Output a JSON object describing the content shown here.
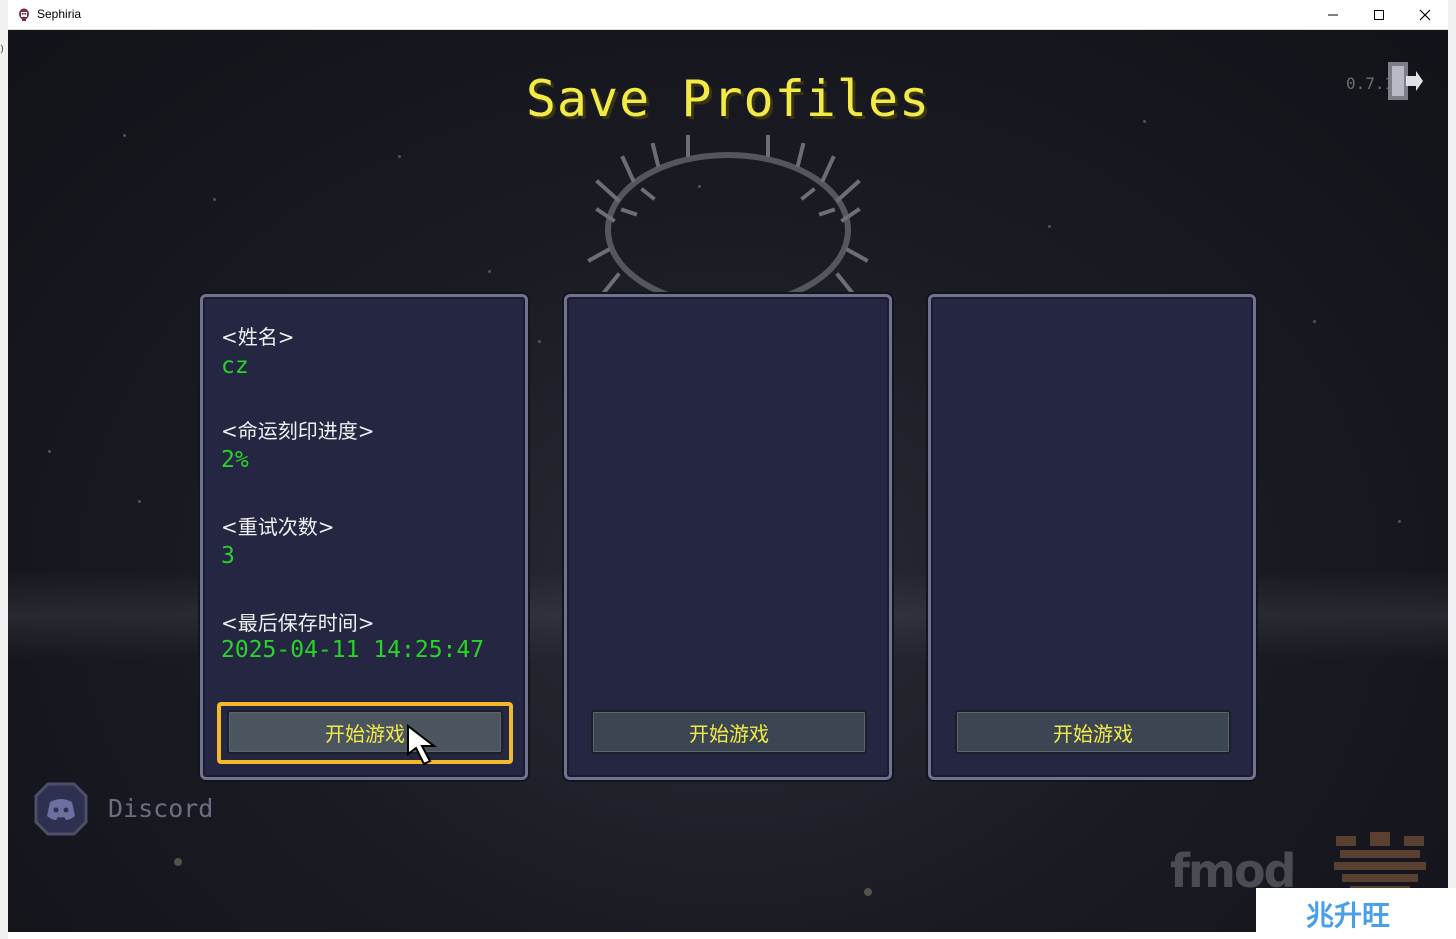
{
  "window": {
    "title": "Sephiria",
    "left_edge_text": ")"
  },
  "screen": {
    "title": "Save Profiles",
    "version": "0.7.1"
  },
  "profiles": [
    {
      "fields": [
        {
          "label": "<姓名>",
          "value": "cz"
        },
        {
          "label": "<命运刻印进度>",
          "value": "2%"
        },
        {
          "label": "<重试次数>",
          "value": "3"
        },
        {
          "label": "<最后保存时间>",
          "value": "2025-04-11 14:25:47"
        }
      ],
      "button_label": "开始游戏",
      "selected": true
    },
    {
      "fields": [],
      "button_label": "开始游戏",
      "selected": false
    },
    {
      "fields": [],
      "button_label": "开始游戏",
      "selected": false
    }
  ],
  "footer": {
    "discord_label": "Discord",
    "fmod_logo": "fmod"
  },
  "watermark": {
    "text": "兆升旺"
  },
  "colors": {
    "title_yellow": "#f2ea46",
    "value_green": "#2bd22b",
    "select_orange": "#f2b928",
    "card_bg": "#252642"
  },
  "icons": [
    "app-icon",
    "minimize-icon",
    "maximize-icon",
    "close-icon",
    "exit-door-icon",
    "discord-icon",
    "mouse-cursor-icon"
  ]
}
